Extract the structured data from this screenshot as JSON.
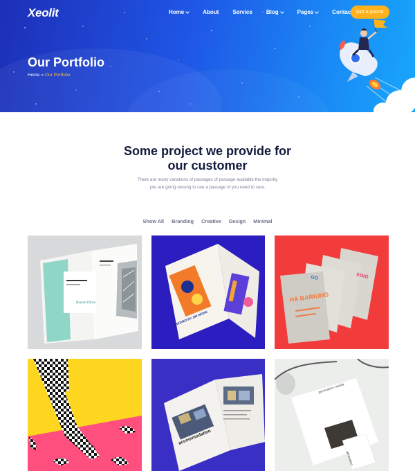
{
  "brand": {
    "logo": "Xeolit"
  },
  "nav": {
    "items": [
      {
        "label": "Home",
        "dropdown": true
      },
      {
        "label": "About",
        "dropdown": false
      },
      {
        "label": "Service",
        "dropdown": false
      },
      {
        "label": "Blog",
        "dropdown": true
      },
      {
        "label": "Pages",
        "dropdown": true
      },
      {
        "label": "Contact",
        "dropdown": false
      }
    ],
    "cta": "GET A QUOTE"
  },
  "hero": {
    "title": "Our Portfolio",
    "breadcrumb": {
      "home": "Home",
      "separator": "»",
      "current": "Our Portfolio"
    }
  },
  "section": {
    "title_line1": "Some project we provide for",
    "title_line2": "our customer",
    "desc_line1": "There are many variations of passages of passage available the majority",
    "desc_line2": "you are going rassing to use a passage of you need to sure."
  },
  "filters": [
    "Show All",
    "Branding",
    "Creative",
    "Design",
    "Minimal"
  ],
  "portfolio": {
    "items": [
      {
        "caption": "Branch Office"
      },
      {
        "caption": "DESIGNED BY JIM WONG"
      },
      {
        "caption": "HA BARKING"
      },
      {
        "caption": ""
      },
      {
        "caption": "accommodation"
      },
      {
        "caption": "generation media"
      }
    ]
  },
  "colors": {
    "hero_start": "#1d2fb7",
    "hero_end": "#17a7fb",
    "cta": "#ffb21c",
    "breadcrumb_active": "#ffc233",
    "title": "#141a3c"
  }
}
